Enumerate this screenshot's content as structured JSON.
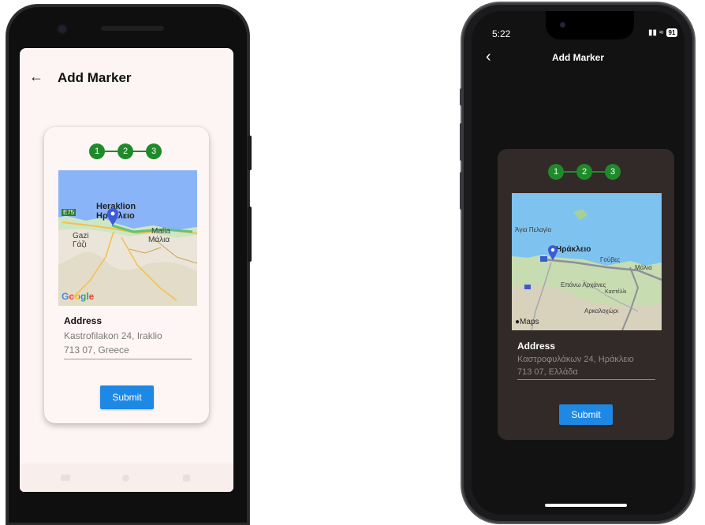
{
  "android": {
    "app_bar": {
      "back_icon": "arrow-left-icon",
      "title": "Add Marker"
    },
    "stepper": [
      "1",
      "2",
      "3"
    ],
    "map": {
      "labels": [
        "Heraklion",
        "Ηράκλειο",
        "Gazi",
        "Γάζι",
        "Malia",
        "Μάλια"
      ],
      "road_badge": "E75",
      "logo": "Google"
    },
    "address": {
      "label": "Address",
      "line1": "Kastrofilakon 24, Iraklio",
      "line2": "713 07, Greece"
    },
    "submit_label": "Submit"
  },
  "iphone": {
    "status_bar": {
      "time": "5:22",
      "battery": "91"
    },
    "app_bar": {
      "back_icon": "chevron-left-icon",
      "title": "Add Marker"
    },
    "stepper": [
      "1",
      "2",
      "3"
    ],
    "map": {
      "labels": [
        "Άγια Πελαγία",
        "Ηράκλειο",
        "Γούβες",
        "Μάλια",
        "Επάνω Αρχάνες",
        "Καστέλλι",
        "Αρκαλοχώρι"
      ],
      "logo": "Maps"
    },
    "address": {
      "label": "Address",
      "line1": "Καστροφυλάκων 24, Ηράκλειο",
      "line2": "713 07, Ελλάδα"
    },
    "submit_label": "Submit"
  },
  "colors": {
    "step_green": "#1f8a2a",
    "submit_blue": "#1e88e5",
    "dark_card": "#322a29"
  }
}
